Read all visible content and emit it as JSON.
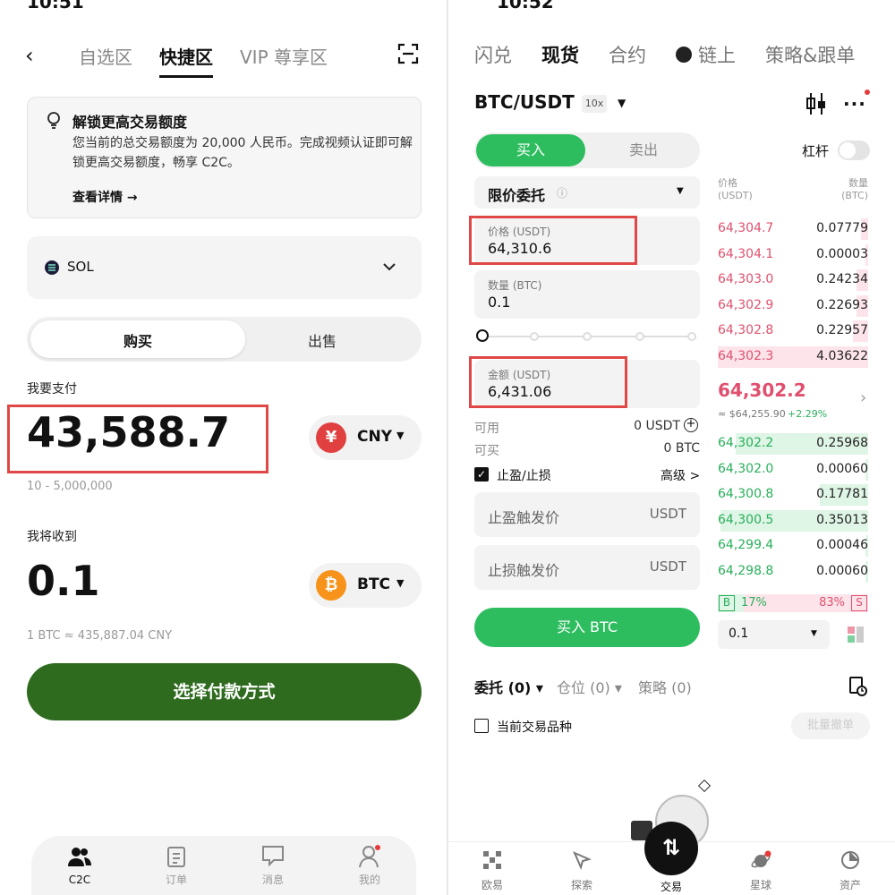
{
  "left": {
    "status": "10:51",
    "tabs": [
      "自选区",
      "快捷区",
      "VIP 尊享区"
    ],
    "notice": {
      "title": "解锁更高交易额度",
      "body": "您当前的总交易额度为 20,000 人民币。完成视频认证即可解锁更高交易额度，畅享 C2C。",
      "link": "查看详情 →"
    },
    "coin": "SOL",
    "segment": [
      "购买",
      "出售"
    ],
    "pay_label": "我要支付",
    "pay_amount": "43,588.7",
    "pay_currency": "CNY",
    "pay_range": "10 - 5,000,000",
    "receive_label": "我将收到",
    "receive_amount": "0.1",
    "receive_currency": "BTC",
    "rate": "1 BTC ≈ 435,887.04 CNY",
    "cta": "选择付款方式",
    "nav": [
      "C2C",
      "订单",
      "消息",
      "我的"
    ],
    "colors": {
      "cta": "#2e6b1e",
      "cny": "#e04040",
      "btc": "#f7931a",
      "highlight": "#e04848"
    }
  },
  "right": {
    "status": "10:52",
    "tabs": [
      "闪兑",
      "现货",
      "合约",
      "链上",
      "策略&跟单"
    ],
    "pair": "BTC/USDT",
    "leverage": "10x",
    "buy": "买入",
    "sell": "卖出",
    "margin_label": "杠杆",
    "order_type": "限价委托",
    "price_label": "价格 (USDT)",
    "price_value": "64,310.6",
    "qty_label": "数量 (BTC)",
    "qty_value": "0.1",
    "amount_label": "金额 (USDT)",
    "amount_value": "6,431.06",
    "available_label": "可用",
    "available_value": "0 USDT",
    "can_buy_label": "可买",
    "can_buy_value": "0 BTC",
    "tpsl_label": "止盈/止损",
    "advanced": "高级 >",
    "tp_placeholder": "止盈触发价",
    "sl_placeholder": "止损触发价",
    "unit": "USDT",
    "buy_button": "买入 BTC",
    "ob_head_price": [
      "价格",
      "(USDT)"
    ],
    "ob_head_qty": [
      "数量",
      "(BTC)"
    ],
    "asks": [
      {
        "price": "64,304.7",
        "qty": "0.07779",
        "depth": 0.05
      },
      {
        "price": "64,304.1",
        "qty": "0.00003",
        "depth": 0.02
      },
      {
        "price": "64,303.0",
        "qty": "0.24234",
        "depth": 0.08
      },
      {
        "price": "64,302.9",
        "qty": "0.22693",
        "depth": 0.08
      },
      {
        "price": "64,302.8",
        "qty": "0.22957",
        "depth": 0.1
      },
      {
        "price": "64,302.3",
        "qty": "4.03622",
        "depth": 1.0
      }
    ],
    "last_price": "64,302.2",
    "last_sub": "≈ $64,255.90",
    "last_change": "+2.29%",
    "bids": [
      {
        "price": "64,302.2",
        "qty": "0.25968",
        "depth": 0.88
      },
      {
        "price": "64,302.0",
        "qty": "0.00060",
        "depth": 0.02
      },
      {
        "price": "64,300.8",
        "qty": "0.17781",
        "depth": 0.32
      },
      {
        "price": "64,300.5",
        "qty": "0.35013",
        "depth": 0.98
      },
      {
        "price": "64,299.4",
        "qty": "0.00046",
        "depth": 0.02
      },
      {
        "price": "64,298.8",
        "qty": "0.00060",
        "depth": 0.02
      }
    ],
    "ratio_b_label": "B",
    "ratio_b": "17%",
    "ratio_s": "83%",
    "ratio_s_label": "S",
    "ratio_b_value": 0.17,
    "depth_select": "0.1",
    "bottom_tabs": [
      "委托 (0)",
      "仓位 (0)",
      "策略 (0)"
    ],
    "current_pair_only": "当前交易品种",
    "batch_cancel": "批量撤单",
    "nav": [
      "欧易",
      "探索",
      "交易",
      "星球",
      "资产"
    ],
    "colors": {
      "buy": "#2dbd5f",
      "ask": "#e0506e",
      "bid": "#28b05a",
      "ask_bg": "#fde4ea",
      "bid_bg": "#dff5e6"
    }
  }
}
